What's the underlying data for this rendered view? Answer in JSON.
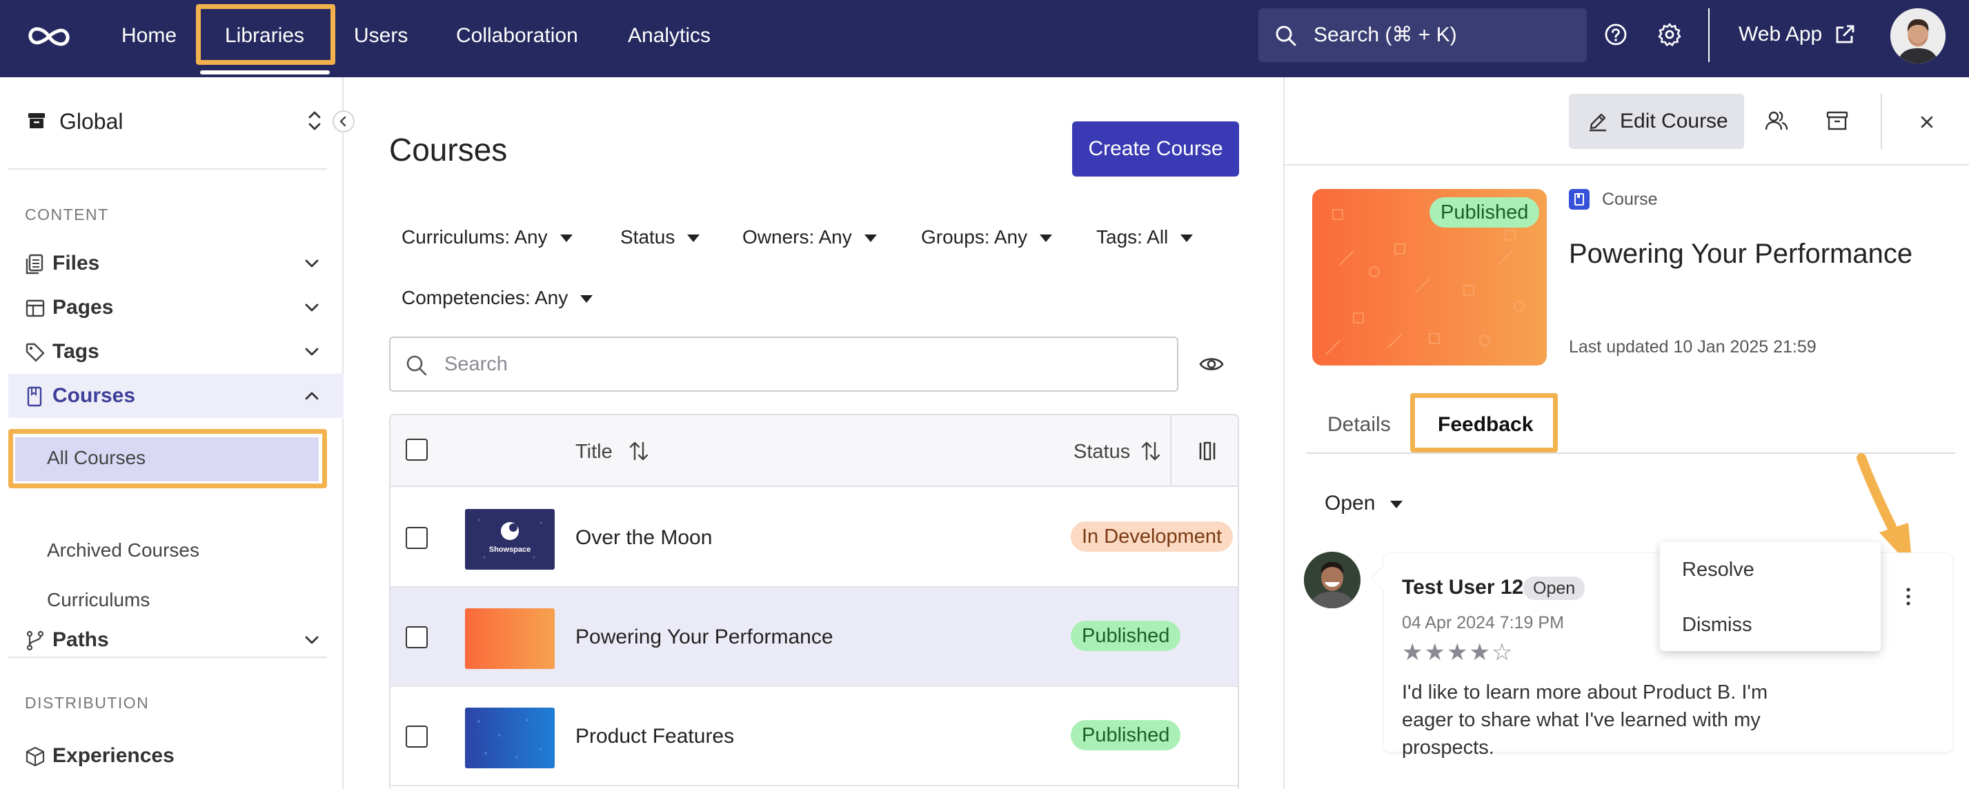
{
  "colors": {
    "nav_bg": "#26295f",
    "primary": "#3a3ab4",
    "highlight": "#f4b24f",
    "published_bg": "#aaf0b6",
    "dev_bg": "#fbd9c2"
  },
  "topnav": {
    "items": [
      "Home",
      "Libraries",
      "Users",
      "Collaboration",
      "Analytics"
    ],
    "active": "Libraries",
    "search": "Search (⌘ + K)",
    "icons": [
      "help-icon",
      "settings-icon"
    ],
    "webapp": "Web App"
  },
  "sidebar": {
    "workspace": "Global",
    "sections": {
      "content": "CONTENT",
      "distribution": "DISTRIBUTION"
    },
    "items": [
      {
        "label": "Files",
        "icon": "files-icon"
      },
      {
        "label": "Pages",
        "icon": "pages-icon"
      },
      {
        "label": "Tags",
        "icon": "tag-icon"
      },
      {
        "label": "Courses",
        "icon": "course-book-icon"
      },
      {
        "label": "Paths",
        "icon": "paths-icon"
      },
      {
        "label": "Experiences",
        "icon": "cube-icon"
      }
    ],
    "sub_items": [
      "All Courses",
      "Archived Courses",
      "Curriculums"
    ]
  },
  "main": {
    "title": "Courses",
    "create_button": "Create Course",
    "filters": [
      "Curriculums: Any",
      "Status",
      "Owners: Any",
      "Groups: Any",
      "Tags: All",
      "Competencies: Any"
    ],
    "search_placeholder": "Search",
    "table": {
      "columns": [
        "Title",
        "Status"
      ],
      "rows": [
        {
          "title": "Over the Moon",
          "status": "In Development",
          "thumb_label": "Showspace"
        },
        {
          "title": "Powering Your Performance",
          "status": "Published"
        },
        {
          "title": "Product Features",
          "status": "Published"
        }
      ]
    }
  },
  "panel": {
    "edit_button": "Edit Course",
    "badge": "Published",
    "type_label": "Course",
    "title": "Powering Your Performance",
    "updated": "Last updated 10 Jan 2025 21:59",
    "tabs": [
      "Details",
      "Feedback"
    ],
    "active_tab": "Feedback",
    "filter": "Open",
    "feedback": {
      "user": "Test User 12",
      "status": "Open",
      "date": "04 Apr 2024 7:19 PM",
      "rating": 4,
      "rating_max": 5,
      "stars": "★★★★☆",
      "text": "I'd like to learn more about Product B. I'm eager to share what I've learned with my prospects."
    },
    "menu": [
      "Resolve",
      "Dismiss"
    ]
  }
}
